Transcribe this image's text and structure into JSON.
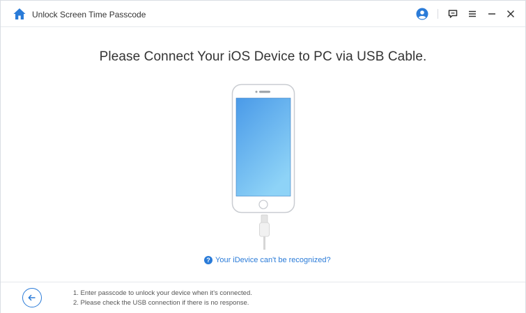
{
  "window": {
    "title": "Unlock Screen Time Passcode",
    "icons": [
      "home-icon",
      "account-icon",
      "feedback-icon",
      "menu-icon",
      "minimize-icon",
      "close-icon"
    ]
  },
  "main": {
    "heading": "Please Connect Your iOS Device to PC via USB Cable.",
    "help_link": "Your iDevice can't be recognized?",
    "help_icon_glyph": "?"
  },
  "footer": {
    "notes": [
      "1. Enter passcode to unlock your device when it's connected.",
      "2. Please check the USB connection if there is no response."
    ]
  },
  "colors": {
    "accent": "#2a7bd8",
    "screen_top": "#4a9ae8",
    "screen_bottom": "#8ed3f7"
  }
}
